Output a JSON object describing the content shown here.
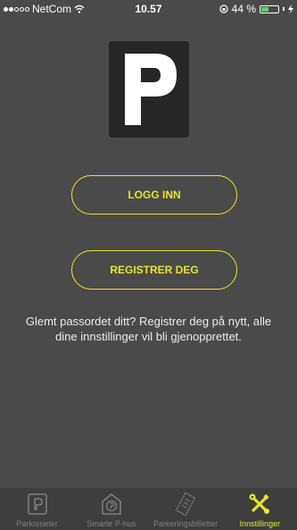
{
  "status_bar": {
    "carrier": "NetCom",
    "time": "10.57",
    "battery_percent": "44 %",
    "battery_level": 0.44,
    "signal_bars_filled": 2
  },
  "logo": {
    "letter": "P"
  },
  "buttons": {
    "login": "LOGG INN",
    "register": "REGISTRER DEG"
  },
  "info_text": "Glemt passordet ditt? Registrer deg på nytt, alle dine innstillinger vil bli gjenopprettet.",
  "tabbar": {
    "tabs": [
      {
        "label": "Parkometer",
        "icon": "parking-meter-icon",
        "active": false
      },
      {
        "label": "Smarte P-hus",
        "icon": "parking-house-icon",
        "active": false
      },
      {
        "label": "Parkeringsbilletter",
        "icon": "ticket-icon",
        "active": false
      },
      {
        "label": "Innstillinger",
        "icon": "wrench-screwdriver-icon",
        "active": true
      }
    ]
  },
  "colors": {
    "background": "#4a4a4a",
    "accent": "#e5e62e",
    "tabbar": "#3e3e3e",
    "inactive_tab": "#7e7e7e"
  }
}
